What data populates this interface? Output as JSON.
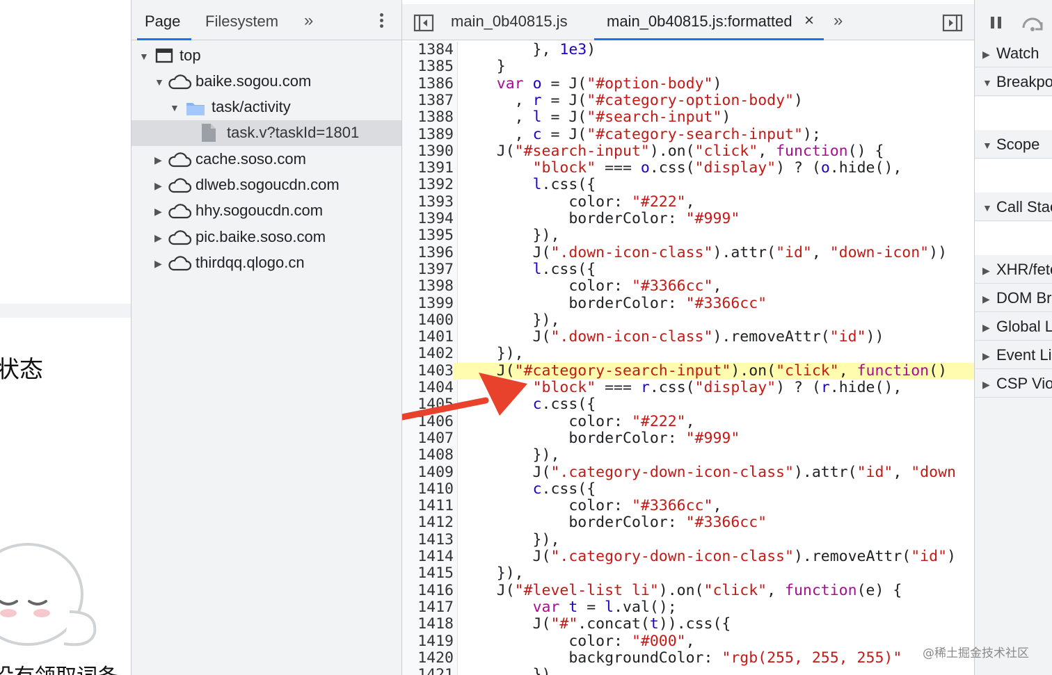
{
  "page_fragment": {
    "status_text": "状态",
    "bottom_text": "没有领取词条"
  },
  "navigator": {
    "tabs": [
      {
        "label": "Page",
        "active": true
      },
      {
        "label": "Filesystem",
        "active": false
      }
    ],
    "more_icon": "double-chevron-right-icon",
    "menu_icon": "kebab-menu-icon",
    "tree": [
      {
        "label": "top",
        "icon": "frame-icon",
        "expanded": true,
        "depth": 0
      },
      {
        "label": "baike.sogou.com",
        "icon": "cloud-icon",
        "expanded": true,
        "depth": 1
      },
      {
        "label": "task/activity",
        "icon": "folder-icon",
        "expanded": true,
        "depth": 2
      },
      {
        "label": "task.v?taskId=1801",
        "icon": "file-icon",
        "selected": true,
        "depth": 3
      },
      {
        "label": "cache.soso.com",
        "icon": "cloud-icon",
        "expanded": false,
        "depth": 1
      },
      {
        "label": "dlweb.sogoucdn.com",
        "icon": "cloud-icon",
        "expanded": false,
        "depth": 1
      },
      {
        "label": "hhy.sogoucdn.com",
        "icon": "cloud-icon",
        "expanded": false,
        "depth": 1
      },
      {
        "label": "pic.baike.soso.com",
        "icon": "cloud-icon",
        "expanded": false,
        "depth": 1
      },
      {
        "label": "thirdqq.qlogo.cn",
        "icon": "cloud-icon",
        "expanded": false,
        "depth": 1
      }
    ]
  },
  "editor": {
    "tabs": [
      {
        "label": "main_0b40815.js",
        "active": false
      },
      {
        "label": "main_0b40815.js:formatted",
        "active": true,
        "close": "×"
      }
    ],
    "highlighted_line": 1403,
    "lines": [
      {
        "n": "1384",
        "code": "        }, 1e3)"
      },
      {
        "n": "1385",
        "code": "    }"
      },
      {
        "n": "1386",
        "code": "    var o = J(\"#option-body\")"
      },
      {
        "n": "1387",
        "code": "      , r = J(\"#category-option-body\")"
      },
      {
        "n": "1388",
        "code": "      , l = J(\"#search-input\")"
      },
      {
        "n": "1389",
        "code": "      , c = J(\"#category-search-input\");"
      },
      {
        "n": "1390",
        "code": "    J(\"#search-input\").on(\"click\", function() {"
      },
      {
        "n": "1391",
        "code": "        \"block\" === o.css(\"display\") ? (o.hide(),"
      },
      {
        "n": "1392",
        "code": "        l.css({"
      },
      {
        "n": "1393",
        "code": "            color: \"#222\","
      },
      {
        "n": "1394",
        "code": "            borderColor: \"#999\""
      },
      {
        "n": "1395",
        "code": "        }),"
      },
      {
        "n": "1396",
        "code": "        J(\".down-icon-class\").attr(\"id\", \"down-icon\"))"
      },
      {
        "n": "1397",
        "code": "        l.css({"
      },
      {
        "n": "1398",
        "code": "            color: \"#3366cc\","
      },
      {
        "n": "1399",
        "code": "            borderColor: \"#3366cc\""
      },
      {
        "n": "1400",
        "code": "        }),"
      },
      {
        "n": "1401",
        "code": "        J(\".down-icon-class\").removeAttr(\"id\"))"
      },
      {
        "n": "1402",
        "code": "    }),"
      },
      {
        "n": "1403",
        "code": "    J(\"#category-search-input\").on(\"click\", function()"
      },
      {
        "n": "1404",
        "code": "        \"block\" === r.css(\"display\") ? (r.hide(),"
      },
      {
        "n": "1405",
        "code": "        c.css({"
      },
      {
        "n": "1406",
        "code": "            color: \"#222\","
      },
      {
        "n": "1407",
        "code": "            borderColor: \"#999\""
      },
      {
        "n": "1408",
        "code": "        }),"
      },
      {
        "n": "1409",
        "code": "        J(\".category-down-icon-class\").attr(\"id\", \"down"
      },
      {
        "n": "1410",
        "code": "        c.css({"
      },
      {
        "n": "1411",
        "code": "            color: \"#3366cc\","
      },
      {
        "n": "1412",
        "code": "            borderColor: \"#3366cc\""
      },
      {
        "n": "1413",
        "code": "        }),"
      },
      {
        "n": "1414",
        "code": "        J(\".category-down-icon-class\").removeAttr(\"id\")"
      },
      {
        "n": "1415",
        "code": "    }),"
      },
      {
        "n": "1416",
        "code": "    J(\"#level-list li\").on(\"click\", function(e) {"
      },
      {
        "n": "1417",
        "code": "        var t = l.val();"
      },
      {
        "n": "1418",
        "code": "        J(\"#\".concat(t)).css({"
      },
      {
        "n": "1419",
        "code": "            color: \"#000\","
      },
      {
        "n": "1420",
        "code": "            backgroundColor: \"rgb(255, 255, 255)\""
      },
      {
        "n": "1421",
        "code": "        })"
      }
    ]
  },
  "debugger": {
    "panes": [
      {
        "label": "Watch",
        "expanded": false
      },
      {
        "label": "Breakpoints",
        "expanded": true
      },
      {
        "label": "Scope",
        "expanded": true
      },
      {
        "label": "Call Stack",
        "expanded": true
      },
      {
        "label": "XHR/fetch Breakpoints",
        "expanded": false
      },
      {
        "label": "DOM Breakpoints",
        "expanded": false
      },
      {
        "label": "Global Listeners",
        "expanded": false
      },
      {
        "label": "Event Listener Breakpoints",
        "expanded": false
      },
      {
        "label": "CSP Violation Breakpoints",
        "expanded": false
      }
    ]
  },
  "watermark": "@稀土掘金技术社区",
  "colors": {
    "accent": "#1a73e8",
    "highlight": "#fffbaf",
    "arrow": "#e8412c",
    "keyword": "#aa0d91",
    "string": "#c41a16",
    "number": "#1c00cf"
  }
}
